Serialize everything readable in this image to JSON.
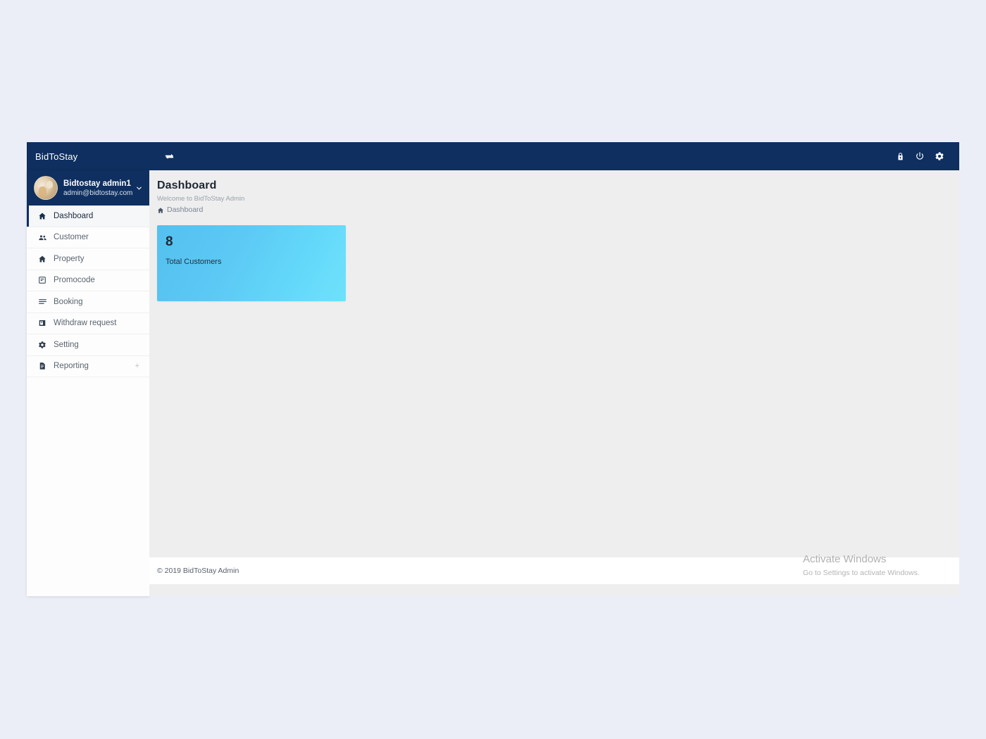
{
  "topbar": {
    "brand": "BidToStay",
    "toggle_icon": "exchange-arrows-icon",
    "icons": [
      {
        "name": "lock-icon",
        "label": "Lock"
      },
      {
        "name": "power-icon",
        "label": "Power"
      },
      {
        "name": "gear-icon",
        "label": "Settings"
      }
    ]
  },
  "sidebar": {
    "profile": {
      "name": "Bidtostay admin1",
      "email": "admin@bidtostay.com",
      "avatar_icon": "user-avatar-photo",
      "caret_icon": "chevron-down-icon"
    },
    "items": [
      {
        "label": "Dashboard",
        "icon": "home-icon",
        "active": true,
        "expandable": false
      },
      {
        "label": "Customer",
        "icon": "people-icon",
        "active": false,
        "expandable": false
      },
      {
        "label": "Property",
        "icon": "home-icon",
        "active": false,
        "expandable": false
      },
      {
        "label": "Promocode",
        "icon": "ticket-icon",
        "active": false,
        "expandable": false
      },
      {
        "label": "Booking",
        "icon": "list-icon",
        "active": false,
        "expandable": false
      },
      {
        "label": "Withdraw request",
        "icon": "card-icon",
        "active": false,
        "expandable": false
      },
      {
        "label": "Setting",
        "icon": "gear-icon",
        "active": false,
        "expandable": false
      },
      {
        "label": "Reporting",
        "icon": "document-icon",
        "active": false,
        "expandable": true,
        "expand_symbol": "+"
      }
    ]
  },
  "main": {
    "page_title": "Dashboard",
    "page_subtitle": "Welcome to BidToStay Admin",
    "breadcrumb": {
      "icon": "home-icon",
      "text": "Dashboard"
    },
    "cards": [
      {
        "value": "8",
        "label": "Total Customers",
        "gradient_from": "#54c0ef",
        "gradient_to": "#6ee2fb"
      }
    ]
  },
  "footer": {
    "copyright": "© 2019 BidToStay Admin"
  },
  "watermark": {
    "title": "Activate Windows",
    "subtitle": "Go to Settings to activate Windows."
  },
  "colors": {
    "header_navy": "#0e2f5f",
    "page_background": "#eceef7",
    "content_background": "#eeeeee",
    "sidebar_background": "#fdfdfd",
    "card_accent": "#5cc8f4"
  }
}
